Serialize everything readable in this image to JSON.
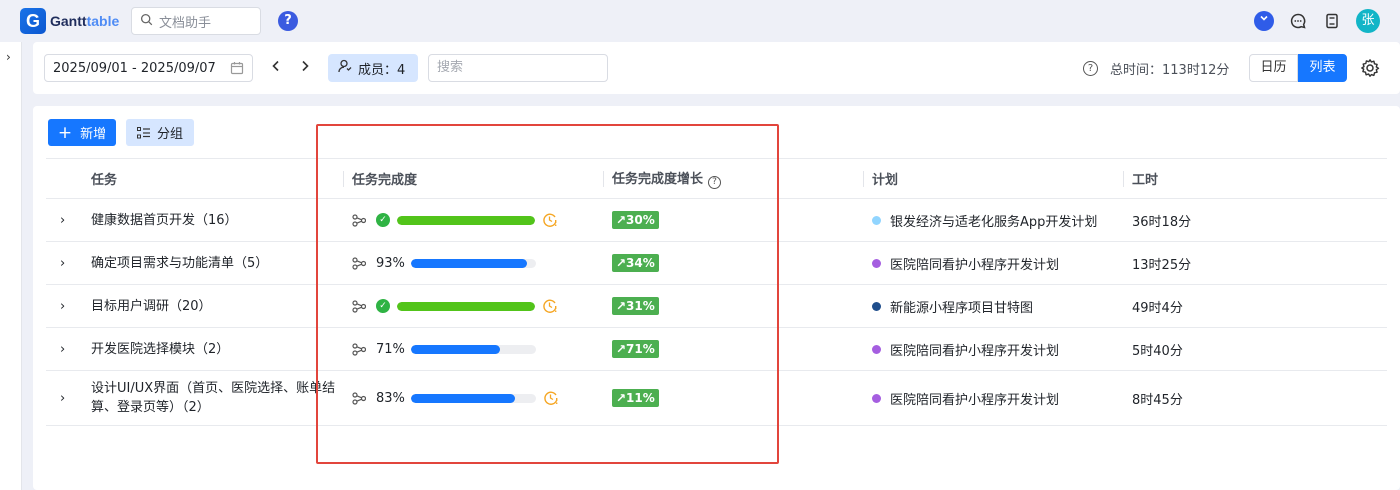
{
  "app": {
    "logo_letter": "G",
    "logo_text_bold": "Gantt",
    "logo_text_light": "table",
    "doc_search_placeholder": "文档助手",
    "help": "?",
    "user_initial": "张"
  },
  "toolbar": {
    "date_range": "2025/09/01 - 2025/09/07",
    "member_label": "成员：4",
    "search_placeholder": "搜索",
    "total_time": "总时间：113时12分",
    "view_calendar": "日历",
    "view_list": "列表"
  },
  "actions": {
    "add_label": "新增",
    "group_label": "分组"
  },
  "table": {
    "headers": {
      "task": "任务",
      "progress": "任务完成度",
      "growth": "任务完成度增长",
      "plan": "计划",
      "hours": "工时"
    },
    "rows": [
      {
        "name": "健康数据首页开发（16）",
        "progress": 100,
        "pct_text": "",
        "complete": true,
        "overdue": true,
        "bar_color": "#52c41a",
        "growth": "↗30%",
        "plan": "银发经济与适老化服务App开发计划",
        "plan_color": "#91d5ff",
        "hours": "36时18分"
      },
      {
        "name": "确定项目需求与功能清单（5）",
        "progress": 93,
        "pct_text": "93%",
        "complete": false,
        "overdue": false,
        "bar_color": "#1677ff",
        "growth": "↗34%",
        "plan": "医院陪同看护小程序开发计划",
        "plan_color": "#a55ee0",
        "hours": "13时25分"
      },
      {
        "name": "目标用户调研（20）",
        "progress": 100,
        "pct_text": "",
        "complete": true,
        "overdue": true,
        "bar_color": "#52c41a",
        "growth": "↗31%",
        "plan": "新能源小程序项目甘特图",
        "plan_color": "#1f4e8c",
        "hours": "49时4分"
      },
      {
        "name": "开发医院选择模块（2）",
        "progress": 71,
        "pct_text": "71%",
        "complete": false,
        "overdue": false,
        "bar_color": "#1677ff",
        "growth": "↗71%",
        "plan": "医院陪同看护小程序开发计划",
        "plan_color": "#a55ee0",
        "hours": "5时40分"
      },
      {
        "name": "设计UI/UX界面（首页、医院选择、账单结算、登录页等）（2）",
        "progress": 83,
        "pct_text": "83%",
        "complete": false,
        "overdue": true,
        "bar_color": "#1677ff",
        "growth": "↗11%",
        "plan": "医院陪同看护小程序开发计划",
        "plan_color": "#a55ee0",
        "hours": "8时45分"
      }
    ]
  },
  "colors": {
    "accent": "#1677ff",
    "growth_badge": "#4caf50",
    "highlight_box": "#e2453c",
    "overdue_clock": "#f5a623"
  }
}
